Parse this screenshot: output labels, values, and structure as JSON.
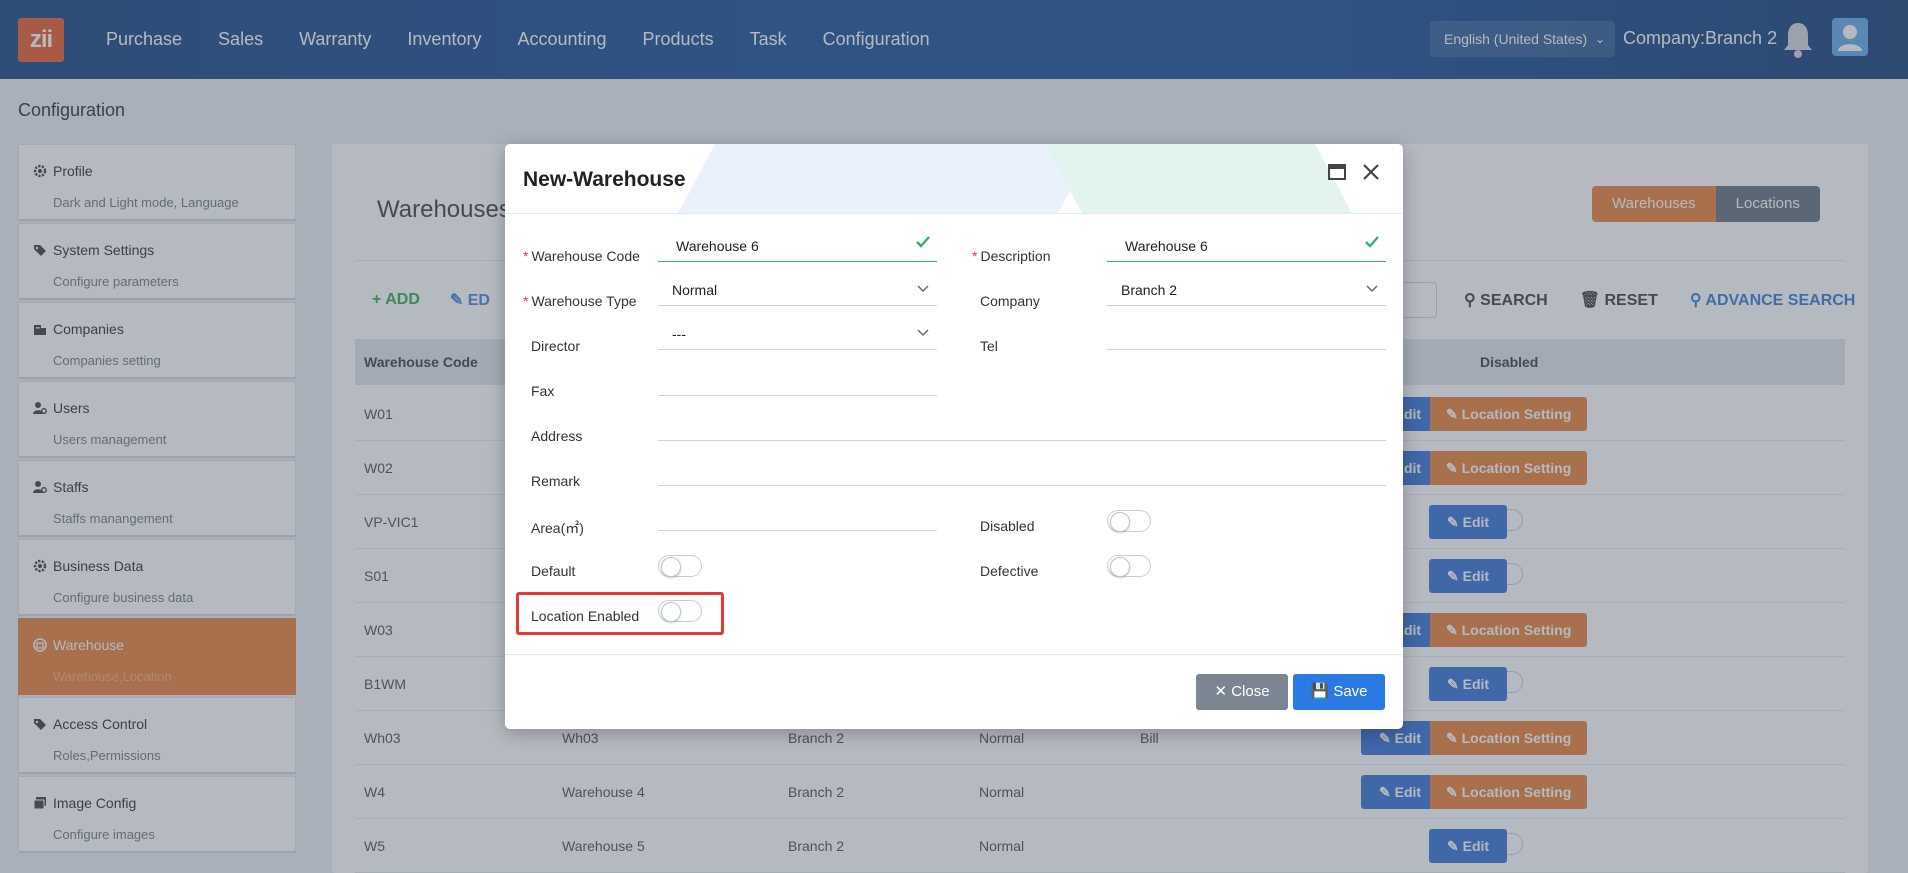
{
  "app": {
    "logo_text": "zii"
  },
  "nav": [
    "Purchase",
    "Sales",
    "Warranty",
    "Inventory",
    "Accounting",
    "Products",
    "Task",
    "Configuration"
  ],
  "header": {
    "language": "English (United States)",
    "company": "Company:Branch 2"
  },
  "page_title": "Configuration",
  "sidebar": {
    "items": [
      {
        "title": "Profile",
        "subtitle": "Dark and Light mode, Language",
        "icon": "gear-icon"
      },
      {
        "title": "System Settings",
        "subtitle": "Configure parameters",
        "icon": "tags-icon"
      },
      {
        "title": "Companies",
        "subtitle": "Companies setting",
        "icon": "building-icon"
      },
      {
        "title": "Users",
        "subtitle": "Users management",
        "icon": "user-gear-icon"
      },
      {
        "title": "Staffs",
        "subtitle": "Staffs manangement",
        "icon": "user-gear-icon"
      },
      {
        "title": "Business Data",
        "subtitle": "Configure business data",
        "icon": "gear-icon"
      },
      {
        "title": "Warehouse",
        "subtitle": "Warehouse,Location",
        "icon": "warehouse-icon",
        "active": true
      },
      {
        "title": "Access Control",
        "subtitle": "Roles,Permissions",
        "icon": "tags-icon"
      },
      {
        "title": "Image Config",
        "subtitle": "Configure images",
        "icon": "images-icon"
      }
    ]
  },
  "main": {
    "title": "Warehouses",
    "tabs": [
      "Warehouses",
      "Locations"
    ],
    "toolbar": {
      "add": "ADD",
      "edit": "ED",
      "search": "SEARCH",
      "reset": "RESET",
      "advance_search": "ADVANCE SEARCH"
    },
    "table": {
      "columns": [
        "Warehouse Code",
        "Disabled"
      ],
      "rows": [
        {
          "code": "W01",
          "name": "",
          "company": "",
          "type": "",
          "director": "",
          "location_setting": true
        },
        {
          "code": "W02",
          "name": "",
          "company": "",
          "type": "",
          "director": "",
          "location_setting": true
        },
        {
          "code": "VP-VIC1",
          "name": "",
          "company": "",
          "type": "",
          "director": "",
          "location_setting": false
        },
        {
          "code": "S01",
          "name": "",
          "company": "",
          "type": "",
          "director": "",
          "location_setting": false
        },
        {
          "code": "W03",
          "name": "",
          "company": "",
          "type": "",
          "director": "",
          "location_setting": true
        },
        {
          "code": "B1WM",
          "name": "",
          "company": "",
          "type": "",
          "director": "",
          "location_setting": false
        },
        {
          "code": "Wh03",
          "name": "Wh03",
          "company": "Branch 2",
          "type": "Normal",
          "director": "Bill",
          "location_setting": true
        },
        {
          "code": "W4",
          "name": "Warehouse 4",
          "company": "Branch 2",
          "type": "Normal",
          "director": "",
          "location_setting": true
        },
        {
          "code": "W5",
          "name": "Warehouse 5",
          "company": "Branch 2",
          "type": "Normal",
          "director": "",
          "location_setting": false
        }
      ],
      "edit_label": "Edit",
      "location_label": "Location Setting"
    }
  },
  "modal": {
    "title": "New-Warehouse",
    "fields": {
      "warehouse_code": {
        "label": "Warehouse Code",
        "value": "Warehouse 6"
      },
      "description": {
        "label": "Description",
        "value": "Warehouse 6"
      },
      "warehouse_type": {
        "label": "Warehouse Type",
        "value": "Normal"
      },
      "company": {
        "label": "Company",
        "value": "Branch 2"
      },
      "director": {
        "label": "Director",
        "value": "---"
      },
      "tel": {
        "label": "Tel",
        "value": ""
      },
      "fax": {
        "label": "Fax",
        "value": ""
      },
      "address": {
        "label": "Address",
        "value": ""
      },
      "remark": {
        "label": "Remark",
        "value": ""
      },
      "area": {
        "label": "Area(㎡)",
        "value": ""
      },
      "disabled": {
        "label": "Disabled",
        "value": false
      },
      "default": {
        "label": "Default",
        "value": false
      },
      "defective": {
        "label": "Defective",
        "value": false
      },
      "location_enabled": {
        "label": "Location Enabled",
        "value": false
      }
    },
    "buttons": {
      "close": "Close",
      "save": "Save"
    }
  },
  "colors": {
    "accent": "#e97a2e",
    "primary": "#2a6ad1",
    "nav": "#0c4591",
    "highlight": "#e53935"
  }
}
